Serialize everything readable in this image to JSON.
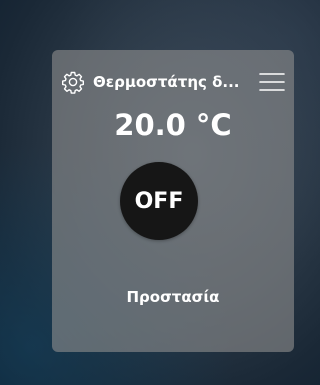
{
  "widget": {
    "title": "Θερμοστάτης δ...",
    "temperature": "20.0 °C",
    "power_label": "OFF",
    "mode_label": "Προστασία",
    "icons": {
      "settings": "gear-icon",
      "menu": "hamburger-menu-icon"
    }
  }
}
